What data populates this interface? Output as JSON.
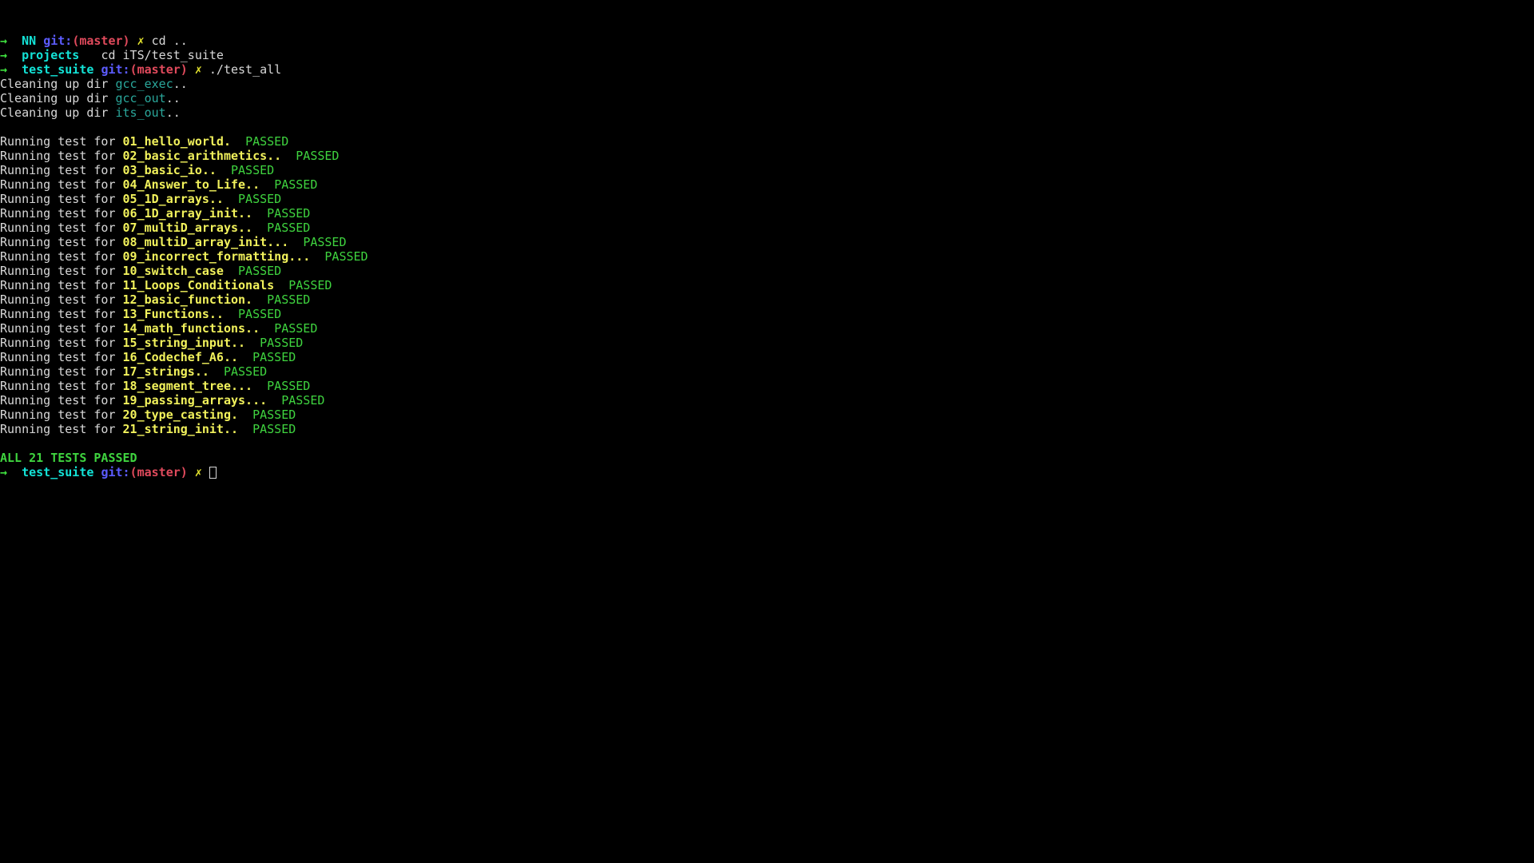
{
  "terminal": {
    "background_color": "#000000",
    "colors": {
      "arrow_green": "#3fe03f",
      "dir_cyan": "#13e3d7",
      "git_blue": "#5c5cff",
      "branch_red": "#e04a5c",
      "x_yellow": "#e6e62e",
      "text_white": "#d8d8d8",
      "dirname_teal": "#2aa79b",
      "testname_yellow": "#f2f25c",
      "passed_green": "#3fd43f"
    },
    "prompt": {
      "arrow": "→",
      "git_keyword": "git:",
      "branch": "(master)",
      "x_mark": "✗"
    },
    "command_lines": [
      {
        "dir": "NN",
        "has_git": true,
        "command": "cd .."
      },
      {
        "dir": "projects",
        "has_git": false,
        "command": "cd iTS/test_suite"
      },
      {
        "dir": "test_suite",
        "has_git": true,
        "command": "./test_all"
      }
    ],
    "cleanup_lines": [
      {
        "prefix": "Cleaning up dir ",
        "dir": "gcc_exec",
        "suffix": ".."
      },
      {
        "prefix": "Cleaning up dir ",
        "dir": "gcc_out",
        "suffix": ".."
      },
      {
        "prefix": "Cleaning up dir ",
        "dir": "its_out",
        "suffix": ".."
      }
    ],
    "run_prefix": "Running test for ",
    "status_label": "PASSED",
    "tests": [
      {
        "name": "01_hello_world.",
        "gap": "  ",
        "status": "PASSED"
      },
      {
        "name": "02_basic_arithmetics..",
        "gap": "  ",
        "status": "PASSED"
      },
      {
        "name": "03_basic_io..",
        "gap": "  ",
        "status": "PASSED"
      },
      {
        "name": "04_Answer_to_Life..",
        "gap": "  ",
        "status": "PASSED"
      },
      {
        "name": "05_1D_arrays..",
        "gap": "  ",
        "status": "PASSED"
      },
      {
        "name": "06_1D_array_init..",
        "gap": "  ",
        "status": "PASSED"
      },
      {
        "name": "07_multiD_arrays..",
        "gap": "  ",
        "status": "PASSED"
      },
      {
        "name": "08_multiD_array_init...",
        "gap": "  ",
        "status": "PASSED"
      },
      {
        "name": "09_incorrect_formatting...",
        "gap": "  ",
        "status": "PASSED"
      },
      {
        "name": "10_switch_case",
        "gap": "  ",
        "status": "PASSED"
      },
      {
        "name": "11_Loops_Conditionals",
        "gap": "  ",
        "status": "PASSED"
      },
      {
        "name": "12_basic_function.",
        "gap": "  ",
        "status": "PASSED"
      },
      {
        "name": "13_Functions..",
        "gap": "  ",
        "status": "PASSED"
      },
      {
        "name": "14_math_functions..",
        "gap": "  ",
        "status": "PASSED"
      },
      {
        "name": "15_string_input..",
        "gap": "  ",
        "status": "PASSED"
      },
      {
        "name": "16_Codechef_A6..",
        "gap": "  ",
        "status": "PASSED"
      },
      {
        "name": "17_strings..",
        "gap": "  ",
        "status": "PASSED"
      },
      {
        "name": "18_segment_tree...",
        "gap": "  ",
        "status": "PASSED"
      },
      {
        "name": "19_passing_arrays...",
        "gap": "  ",
        "status": "PASSED"
      },
      {
        "name": "20_type_casting.",
        "gap": "  ",
        "status": "PASSED"
      },
      {
        "name": "21_string_init..",
        "gap": "  ",
        "status": "PASSED"
      }
    ],
    "summary": "ALL 21 TESTS PASSED",
    "final_prompt": {
      "dir": "test_suite",
      "has_git": true,
      "command": ""
    }
  }
}
